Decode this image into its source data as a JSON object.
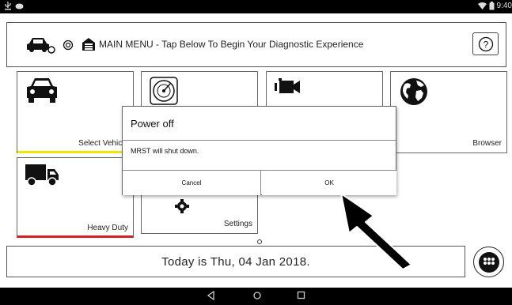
{
  "statusbar": {
    "left_icons": [
      "usb-icon",
      "notification-icon"
    ],
    "right_icons": [
      "wifi-icon",
      "battery-icon"
    ],
    "clock": "9:40"
  },
  "header": {
    "title": "MAIN MENU - Tap Below To Begin Your Diagnostic Experience",
    "help_label": "?"
  },
  "tiles": [
    {
      "label": "Select Vehicle",
      "icon": "car-icon",
      "stripe_color": "#f2e600"
    },
    {
      "label": "",
      "icon": "scope-icon",
      "stripe_color": ""
    },
    {
      "label": "",
      "icon": "camera-icon",
      "stripe_color": ""
    },
    {
      "label": "Browser",
      "icon": "globe-icon",
      "stripe_color": ""
    },
    {
      "label": "Heavy Duty",
      "icon": "truck-icon",
      "stripe_color": "#d42020"
    },
    {
      "label": "Settings",
      "icon": "gear-icon",
      "stripe_color": ""
    }
  ],
  "date_text": "Today is Thu, 04 Jan 2018.",
  "dialog": {
    "title": "Power off",
    "message": "MRST will shut down.",
    "cancel_label": "Cancel",
    "ok_label": "OK"
  },
  "navbar": {
    "icons": [
      "back-icon",
      "home-icon",
      "recents-icon"
    ]
  }
}
